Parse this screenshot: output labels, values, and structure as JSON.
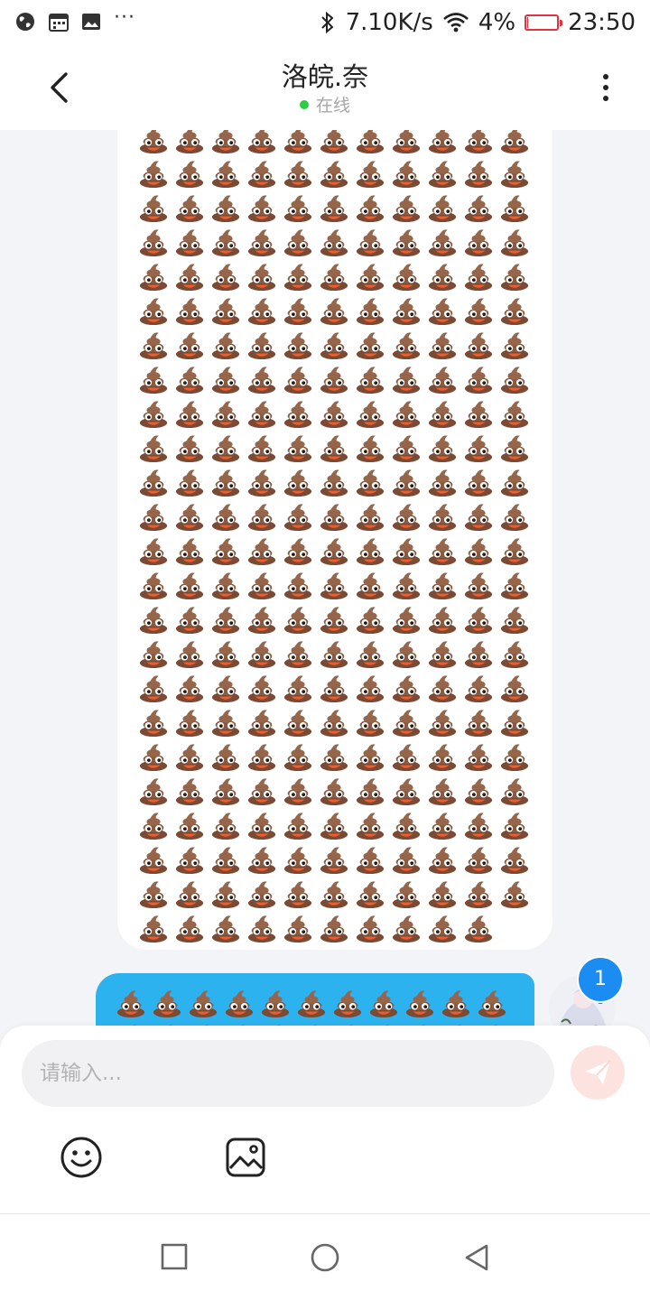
{
  "status_bar": {
    "dots": "···",
    "network_speed": "7.10K/s",
    "battery_percent": "4%",
    "battery_level": 0.04,
    "time": "23:50"
  },
  "header": {
    "title": "洛皖.奈",
    "online_status": "在线"
  },
  "chat": {
    "received_message": {
      "emoji_icon": "pile-of-poo-emoji",
      "full_rows": 24,
      "per_row": 11,
      "last_row_count": 10
    },
    "sent_message": {
      "emoji_icon": "pile-of-poo-emoji",
      "per_row": 11,
      "bubble_color": "#2cb3ef"
    },
    "unread_count": "1"
  },
  "input": {
    "placeholder": "请输入..."
  },
  "colors": {
    "accent": "#2cb3ef",
    "online": "#2ecc40",
    "battery_low": "#e0333f",
    "badge": "#1a8cf2"
  }
}
